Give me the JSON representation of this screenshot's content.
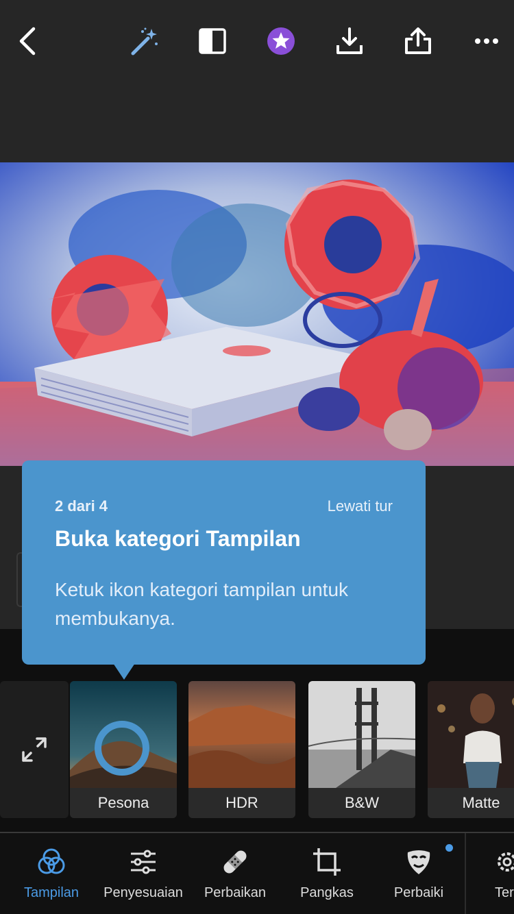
{
  "top_toolbar": {
    "icons": [
      "back-chevron-icon",
      "magic-wand-icon",
      "compare-icon",
      "premium-star-icon",
      "download-icon",
      "share-icon",
      "more-icon"
    ],
    "colors": {
      "premium": "#8a4fd8",
      "wand": "#7fb3e8"
    }
  },
  "tooltip": {
    "step": "2 dari 4",
    "skip": "Lewati tur",
    "title": "Buka kategori Tampilan",
    "body": "Ketuk ikon kategori tampilan untuk membukanya."
  },
  "presets": {
    "items": [
      {
        "label": "Pesona"
      },
      {
        "label": "HDR"
      },
      {
        "label": "B&W"
      },
      {
        "label": "Matte"
      }
    ]
  },
  "bottom_nav": {
    "items": [
      {
        "label": "Tampilan",
        "icon": "looks-icon",
        "active": true
      },
      {
        "label": "Penyesuaian",
        "icon": "sliders-icon",
        "active": false
      },
      {
        "label": "Perbaikan",
        "icon": "bandage-icon",
        "active": false
      },
      {
        "label": "Pangkas",
        "icon": "crop-icon",
        "active": false
      },
      {
        "label": "Perbaiki",
        "icon": "mask-icon",
        "active": false,
        "badge": true
      },
      {
        "label": "Ter",
        "icon": "gear-icon",
        "active": false
      }
    ],
    "colors": {
      "active": "#4b9be6"
    }
  }
}
